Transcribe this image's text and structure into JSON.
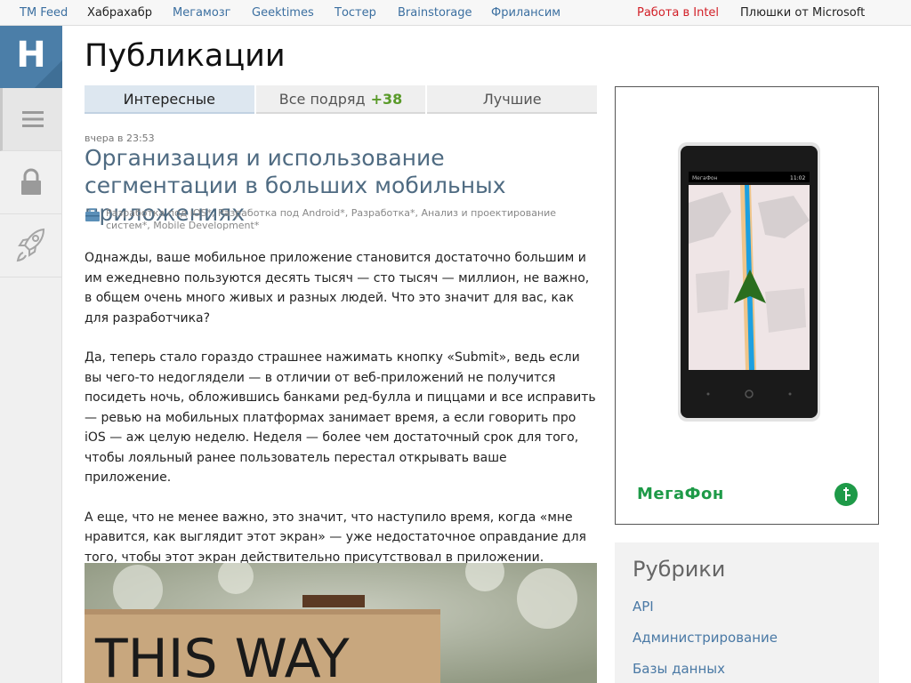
{
  "topbar": {
    "links": [
      "TM Feed",
      "Хабрахабр",
      "Мегамозг",
      "Geektimes",
      "Тостер",
      "Brainstorage",
      "Фрилансим"
    ],
    "promo_intel": "Работа в Intel",
    "promo_ms": "Плюшки от Microsoft"
  },
  "sidebar": {
    "logo_letter": "H",
    "icons": [
      "menu-icon",
      "lock-icon",
      "rocket-icon"
    ]
  },
  "page": {
    "title": "Публикации"
  },
  "tabs": [
    {
      "label": "Интересные",
      "active": true
    },
    {
      "label": "Все подряд",
      "count": "+38"
    },
    {
      "label": "Лучшие"
    }
  ],
  "post": {
    "time": "вчера в 23:53",
    "title": "Организация и использование сегментации в больших мобильных приложениях",
    "hubs": "Разработка под iOS*, Разработка под Android*, Разработка*, Анализ и проектирование систем*, Mobile Development*",
    "paragraphs": [
      "Однажды, ваше мобильное приложение становится достаточно большим и им ежедневно пользуются десять тысяч — сто тысяч — миллион, не важно, в общем очень много живых и разных людей. Что это значит для вас, как для разработчика?",
      "Да, теперь стало гораздо страшнее нажимать кнопку «Submit», ведь если вы чего-то недоглядели — в отличии от веб-приложений не получится посидеть ночь, обложившись банками ред-булла и пиццами и все исправить — ревью на мобильных платформах занимает время, а если говорить про iOS — аж целую неделю. Неделя — более чем достаточный срок для того, чтобы лояльный ранее пользователь перестал открывать ваше приложение.",
      "А еще, что не менее важно, это значит, что наступило время, когда «мне нравится, как выглядит этот экран» — уже недостаточное оправдание для того, чтобы этот экран действительно присутствовал в приложении."
    ],
    "image_text": "THIS WAY"
  },
  "ad": {
    "brand": "МегаФон",
    "phone_status_time": "11:02",
    "phone_operator": "МегаФон"
  },
  "rubrics": {
    "title": "Рубрики",
    "items": [
      "API",
      "Администрирование",
      "Базы данных"
    ]
  },
  "colors": {
    "logo_bg": "#4b7ea8",
    "link": "#3b6fa0",
    "accent_red": "#d21f27",
    "megafon_green": "#1e9a48",
    "count_green": "#5a9a2a"
  }
}
